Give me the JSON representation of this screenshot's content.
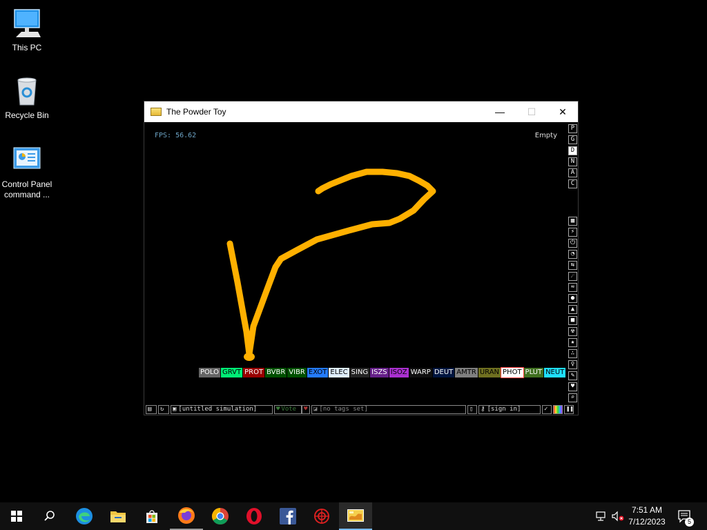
{
  "desktop": {
    "icons": [
      {
        "label": "This PC",
        "icon": "computer-icon"
      },
      {
        "label": "Recycle Bin",
        "icon": "recycle-bin-icon"
      },
      {
        "label": "Control Panel command ...",
        "icon": "control-panel-icon"
      }
    ]
  },
  "window": {
    "title": "The Powder Toy",
    "controls": {
      "minimize": "—",
      "maximize": "☐",
      "close": "✕"
    }
  },
  "sim": {
    "fps_label": "FPS: 56.62",
    "status": "Empty",
    "stroke_color": "#ffb000"
  },
  "right_menu": {
    "top_buttons": [
      "P",
      "G",
      "D",
      "N",
      "A",
      "C"
    ],
    "selected_top": "D",
    "category_icons": [
      "walls-icon",
      "electronics-icon",
      "powered-icon",
      "sensors-icon",
      "force-icon",
      "explosives-icon",
      "gases-icon",
      "liquids-icon",
      "powders-icon",
      "solids-icon",
      "radioactive-icon",
      "special-icon",
      "particles-icon",
      "life-icon",
      "tools-icon",
      "favorites-icon",
      "search-icon"
    ]
  },
  "elements": [
    {
      "name": "POLO",
      "bg": "#666666",
      "fg": "#ffffff"
    },
    {
      "name": "GRVT",
      "bg": "#00ee76",
      "fg": "#000000"
    },
    {
      "name": "PROT",
      "bg": "#990000",
      "fg": "#ffffff"
    },
    {
      "name": "BVBR",
      "bg": "#005000",
      "fg": "#ffffff"
    },
    {
      "name": "VIBR",
      "bg": "#005000",
      "fg": "#ffffff"
    },
    {
      "name": "EXOT",
      "bg": "#247bfe",
      "fg": "#000000"
    },
    {
      "name": "ELEC",
      "bg": "#dfefff",
      "fg": "#000000"
    },
    {
      "name": "SING",
      "bg": "#242424",
      "fg": "#ffffff"
    },
    {
      "name": "ISZS",
      "bg": "#662089",
      "fg": "#ffffff"
    },
    {
      "name": "ISOZ",
      "bg": "#aa30d0",
      "fg": "#000000"
    },
    {
      "name": "WARP",
      "bg": "#101010",
      "fg": "#ffffff"
    },
    {
      "name": "DEUT",
      "bg": "#00153f",
      "fg": "#ffffff"
    },
    {
      "name": "AMTR",
      "bg": "#808080",
      "fg": "#000000"
    },
    {
      "name": "URAN",
      "bg": "#707020",
      "fg": "#000000"
    },
    {
      "name": "PHOT",
      "bg": "#ffffff",
      "fg": "#000000",
      "selected": true
    },
    {
      "name": "PLUT",
      "bg": "#407020",
      "fg": "#ffffff"
    },
    {
      "name": "NEUT",
      "bg": "#20e0ff",
      "fg": "#000000"
    }
  ],
  "bottombar": {
    "sim_name": "[untitled simulation]",
    "vote_label": "Vote",
    "tags": "[no tags set]",
    "signin": "[sign in]"
  },
  "taskbar": {
    "apps": [
      "start-icon",
      "search-icon",
      "edge-icon",
      "file-explorer-icon",
      "store-icon",
      "firefox-icon",
      "chrome-icon",
      "opera-icon",
      "facebook-icon",
      "app-icon",
      "powder-toy-icon"
    ],
    "time": "7:51 AM",
    "date": "7/12/2023",
    "notification_count": "5"
  }
}
